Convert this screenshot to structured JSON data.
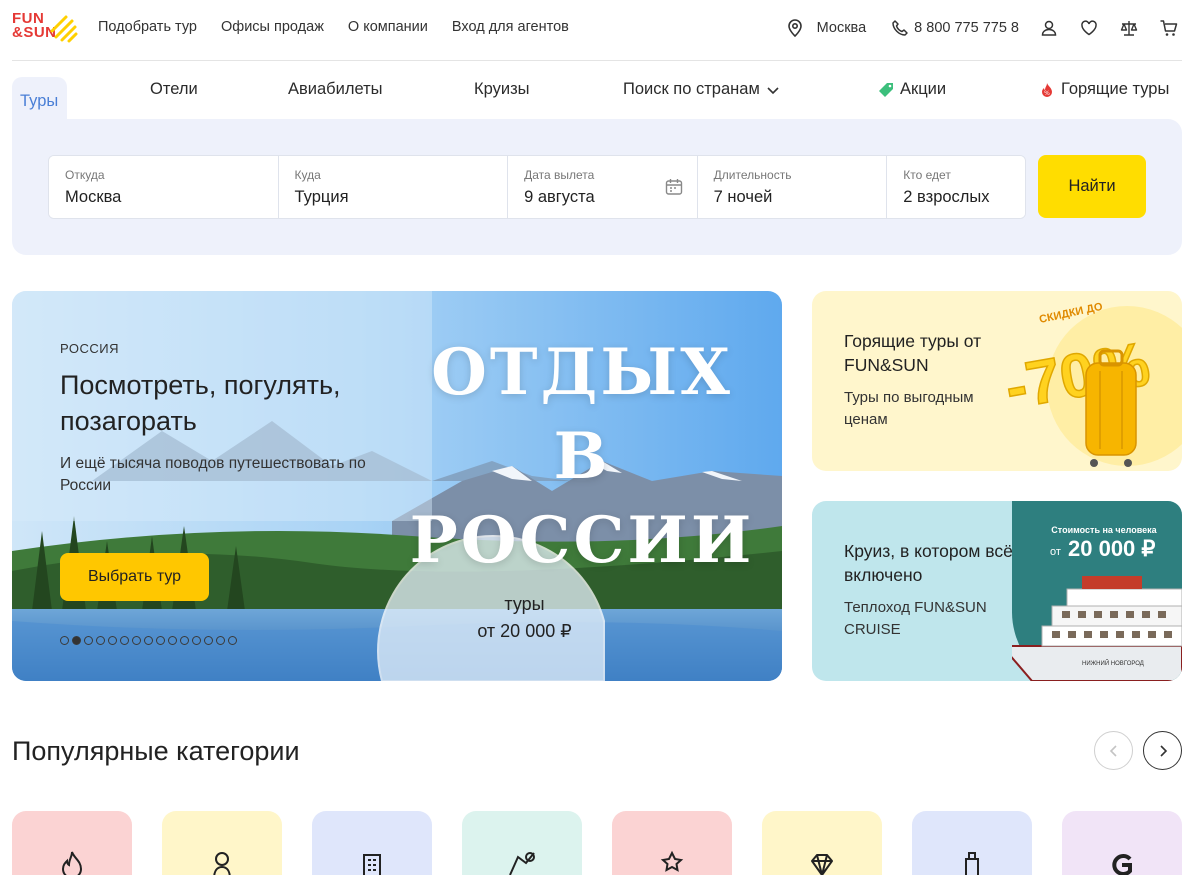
{
  "brand": {
    "logo_line1": "FUN",
    "logo_line2": "&SUN"
  },
  "nav": {
    "items": [
      "Подобрать тур",
      "Офисы продаж",
      "О компании",
      "Вход для агентов"
    ]
  },
  "header": {
    "city": "Москва",
    "phone": "8 800 775 775 8",
    "icons": [
      "location-pin-icon",
      "phone-icon",
      "user-icon",
      "heart-icon",
      "compare-scales-icon",
      "cart-icon"
    ]
  },
  "tabs": {
    "tours": "Туры",
    "hotels": "Отели",
    "flights": "Авиабилеты",
    "cruises": "Круизы",
    "countries": "Поиск по странам",
    "promos": "Акции",
    "hot": "Горящие туры"
  },
  "search": {
    "from_label": "Откуда",
    "from_value": "Москва",
    "to_label": "Куда",
    "to_value": "Турция",
    "date_label": "Дата вылета",
    "date_value": "9 августа",
    "duration_label": "Длительность",
    "duration_value": "7 ночей",
    "guests_label": "Кто едет",
    "guests_value": "2  взрослых",
    "submit": "Найти"
  },
  "hero": {
    "kicker": "РОССИЯ",
    "title": "Посмотреть, погулять, позагорать",
    "subtitle": "И ещё тысяча поводов путешествовать по России",
    "big_line1": "ОТДЫХ",
    "big_line2": "В РОССИИ",
    "button": "Выбрать тур",
    "price_line1": "туры",
    "price_line2": "от 20 000 ₽",
    "slides_total": 15,
    "slide_active": 2
  },
  "promo_hot": {
    "title": "Горящие туры от FUN&SUN",
    "subtitle": "Туры по выгодным ценам",
    "badge_small": "СКИДКИ ДО",
    "badge_big": "-70%"
  },
  "promo_cruise": {
    "title": "Круиз, в котором всё включено",
    "subtitle": "Теплоход FUN&SUN CRUISE",
    "price_caption": "Стоимость на человека",
    "price_prefix": "от",
    "price_value": "20 000 ₽",
    "ship_name": "НИЖНИЙ НОВГОРОД"
  },
  "categories": {
    "title": "Популярные категории",
    "cards": [
      {
        "color": "#fbd3d3",
        "icon": "flame-icon"
      },
      {
        "color": "#fff6c9",
        "icon": "matryoshka-icon"
      },
      {
        "color": "#dfe6fb",
        "icon": "hotel-building-icon"
      },
      {
        "color": "#dcf3ee",
        "icon": "map-route-icon"
      },
      {
        "color": "#fbd3d3",
        "icon": "star-beach-icon"
      },
      {
        "color": "#fff6c9",
        "icon": "diamond-icon"
      },
      {
        "color": "#dfe6fb",
        "icon": "tower-icon"
      },
      {
        "color": "#f1e4f7",
        "icon": "letter-g-icon"
      }
    ]
  },
  "colors": {
    "accent_yellow": "#ffdd00",
    "accent_blue": "#4a7fd6",
    "panel": "#eef1fb"
  }
}
